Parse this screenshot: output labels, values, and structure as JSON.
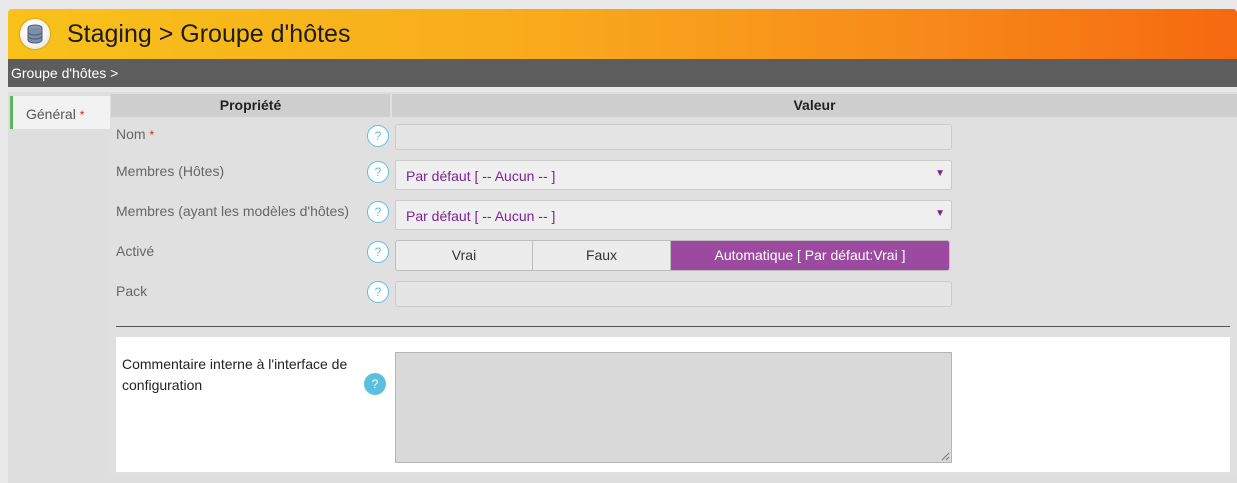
{
  "header": {
    "title": "Staging > Groupe d'hôtes",
    "icon": "database-icon"
  },
  "breadcrumb": {
    "text": "Groupe d'hôtes >"
  },
  "tabs": [
    {
      "label": "Général",
      "required_mark": "*"
    }
  ],
  "table": {
    "col_property": "Propriété",
    "col_value": "Valeur"
  },
  "help_glyph": "?",
  "fields": {
    "nom": {
      "label": "Nom",
      "required_mark": "*",
      "value": ""
    },
    "membres_hotes": {
      "label": "Membres (Hôtes)",
      "value": "Par défaut [ -- Aucun -- ]",
      "caret": "▼"
    },
    "membres_modeles": {
      "label": "Membres (ayant les modèles d'hôtes)",
      "value": "Par défaut [ -- Aucun -- ]",
      "caret": "▼"
    },
    "active": {
      "label": "Activé",
      "options": [
        "Vrai",
        "Faux",
        "Automatique [ Par défaut:Vrai ]"
      ],
      "selected": "Automatique [ Par défaut:Vrai ]"
    },
    "pack": {
      "label": "Pack",
      "value": ""
    }
  },
  "comment": {
    "label": "Commentaire interne à l'interface de configuration",
    "value": ""
  },
  "colors": {
    "accent_purple": "#9c4a9f",
    "header_orange": "#f7891a",
    "help_blue": "#5bc0de",
    "tab_green": "#5cb85c"
  }
}
